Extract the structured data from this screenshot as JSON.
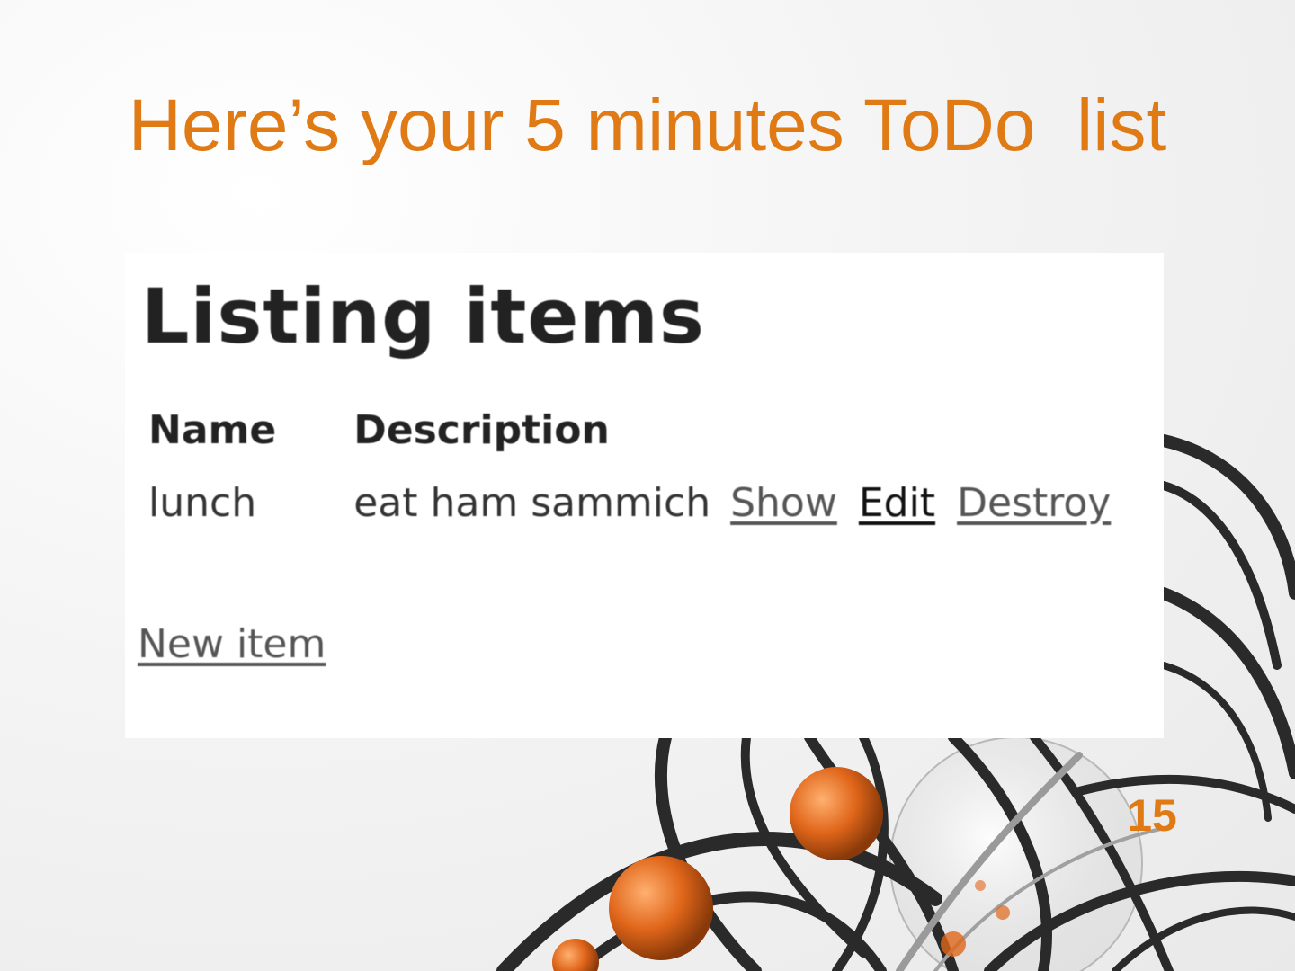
{
  "slide": {
    "title": "Here’s your 5 minutes ToDo  list",
    "page_number": "15"
  },
  "colors": {
    "accent": "#e07a14",
    "background": "#f4f4f4",
    "wire": "#2a2a2a"
  },
  "app": {
    "heading": "Listing items",
    "table": {
      "headers": [
        "Name",
        "Description"
      ],
      "rows": [
        {
          "name": "lunch",
          "description": "eat ham sammich",
          "actions": [
            "Show",
            "Edit",
            "Destroy"
          ]
        }
      ]
    },
    "new_item_label": "New item"
  }
}
